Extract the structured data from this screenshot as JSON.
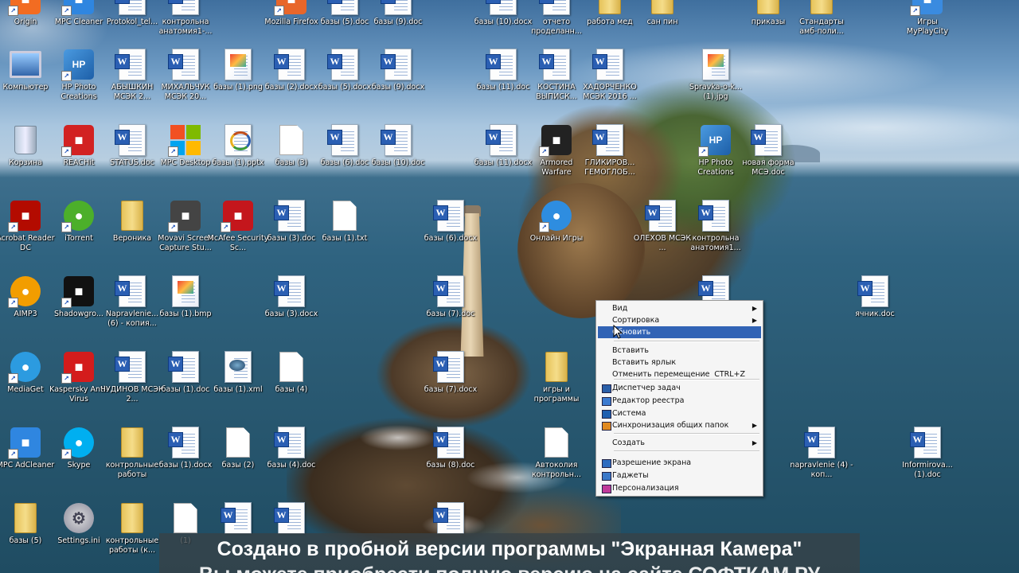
{
  "desktop_icons": [
    {
      "label": "Origin",
      "type": "app",
      "color": "#f26c22"
    },
    {
      "label": "MPC Cleaner",
      "type": "app",
      "color": "#2f86e0"
    },
    {
      "label": "Protokol_tel...",
      "type": "doc"
    },
    {
      "label": "контрольна анатомия1-...",
      "type": "doc"
    },
    {
      "label": "Mozilla Firefox",
      "type": "app",
      "color": "#e8662a"
    },
    {
      "label": "базы (5).doc",
      "type": "doc"
    },
    {
      "label": "базы (9).doc",
      "type": "doc"
    },
    {
      "label": "базы (10).docx",
      "type": "doc"
    },
    {
      "label": "отчето проделанн...",
      "type": "doc"
    },
    {
      "label": "работа мед",
      "type": "folder"
    },
    {
      "label": "сан пин",
      "type": "folder"
    },
    {
      "label": "приказы",
      "type": "folder"
    },
    {
      "label": "Стандарты амб-поли...",
      "type": "folder"
    },
    {
      "label": "Игры MyPlayCity",
      "type": "app",
      "color": "#3a8be0"
    },
    {
      "label": "Компьютер",
      "type": "computer"
    },
    {
      "label": "HP Photo Creations",
      "type": "hp"
    },
    {
      "label": "АБЫШКИН МСЭК 2...",
      "type": "doc"
    },
    {
      "label": "МИХАЛЬЧУК МСЭК 20...",
      "type": "doc"
    },
    {
      "label": "базы (1).png",
      "type": "img"
    },
    {
      "label": "базы (2).docx",
      "type": "doc"
    },
    {
      "label": "базы (5).docx",
      "type": "doc"
    },
    {
      "label": "базы (9).docx",
      "type": "doc"
    },
    {
      "label": "базы (11).doc",
      "type": "doc"
    },
    {
      "label": "КОСТИНА ВЫПИСК...",
      "type": "doc"
    },
    {
      "label": "ХАДОРЧЕНКО МСЭК 2016 ...",
      "type": "doc"
    },
    {
      "label": "Spravka-o-k... (1).jpg",
      "type": "img"
    },
    {
      "label": "Корзина",
      "type": "trash"
    },
    {
      "label": "REACHit",
      "type": "app",
      "color": "#d22222"
    },
    {
      "label": "STATUS.doc",
      "type": "doc"
    },
    {
      "label": "MPC Desktop",
      "type": "mswin"
    },
    {
      "label": "базы (1).pptx",
      "type": "pptx"
    },
    {
      "label": "базы (3)",
      "type": "plain"
    },
    {
      "label": "базы (6).doc",
      "type": "doc"
    },
    {
      "label": "базы (10).doc",
      "type": "doc"
    },
    {
      "label": "базы (11).docx",
      "type": "doc"
    },
    {
      "label": "Armored Warfare",
      "type": "app",
      "color": "#222"
    },
    {
      "label": "ГЛИКИРОВ... ГЕМОГЛОБ...",
      "type": "doc"
    },
    {
      "label": "HP Photo Creations",
      "type": "hp"
    },
    {
      "label": "новая форма МСЭ.doc",
      "type": "doc"
    },
    {
      "label": "Acrobat Reader DC",
      "type": "app",
      "color": "#b30b00"
    },
    {
      "label": "iTorrent",
      "type": "round",
      "color": "#4caf2a"
    },
    {
      "label": "Вероника",
      "type": "folder"
    },
    {
      "label": "Movavi Screen Capture Stu...",
      "type": "app",
      "color": "#444"
    },
    {
      "label": "McAfee Security Sc...",
      "type": "app",
      "color": "#c4161c"
    },
    {
      "label": "базы (3).doc",
      "type": "doc"
    },
    {
      "label": "базы (1).txt",
      "type": "plain"
    },
    {
      "label": "базы (6).docx",
      "type": "doc"
    },
    {
      "label": "Онлайн Игры",
      "type": "round",
      "color": "#2e8de0"
    },
    {
      "label": "ОЛЕХОВ МСЭК ...",
      "type": "doc"
    },
    {
      "label": "контрольна анатомия1...",
      "type": "doc"
    },
    {
      "label": "AIMP3",
      "type": "round",
      "color": "#f29d00"
    },
    {
      "label": "Shadowgro...",
      "type": "app",
      "color": "#111"
    },
    {
      "label": "Napravlenie... (6) - копия...",
      "type": "doc"
    },
    {
      "label": "базы (1).bmp",
      "type": "img"
    },
    {
      "label": "базы (3).docx",
      "type": "doc"
    },
    {
      "label": "базы (7).doc",
      "type": "doc"
    },
    {
      "label": "",
      "type": "doc"
    },
    {
      "label": "ячник.doc",
      "type": "doc"
    },
    {
      "label": "MediaGet",
      "type": "round",
      "color": "#2c9be0"
    },
    {
      "label": "Kaspersky Anti-Virus",
      "type": "app",
      "color": "#d41c1c"
    },
    {
      "label": "ЧУДИНОВ МСЭК 2...",
      "type": "doc"
    },
    {
      "label": "базы (1).doc",
      "type": "doc"
    },
    {
      "label": "базы (1).xml",
      "type": "xml"
    },
    {
      "label": "базы (4)",
      "type": "plain"
    },
    {
      "label": "базы (7).docx",
      "type": "doc"
    },
    {
      "label": "игры и программы",
      "type": "folder"
    },
    {
      "label": "MPC AdCleaner",
      "type": "app",
      "color": "#2f86e0"
    },
    {
      "label": "Skype",
      "type": "round",
      "color": "#00aff0"
    },
    {
      "label": "контрольные работы",
      "type": "folder"
    },
    {
      "label": "базы (1).docx",
      "type": "doc"
    },
    {
      "label": "базы (2)",
      "type": "plain"
    },
    {
      "label": "базы (4).doc",
      "type": "doc"
    },
    {
      "label": "базы (8).doc",
      "type": "doc"
    },
    {
      "label": "Автоколия контрольн...",
      "type": "plain"
    },
    {
      "label": "napravlenie (4) - коп...",
      "type": "doc"
    },
    {
      "label": "Informirova... (1).doc",
      "type": "doc"
    },
    {
      "label": "базы (5)",
      "type": "folder"
    },
    {
      "label": "Settings.ini",
      "type": "ini"
    },
    {
      "label": "контрольные работы (к...",
      "type": "folder"
    },
    {
      "label": "(1)",
      "type": "plain"
    },
    {
      "label": "",
      "type": "doc"
    },
    {
      "label": "",
      "type": "doc"
    },
    {
      "label": "",
      "type": "doc"
    }
  ],
  "context_menu": {
    "items": [
      {
        "label": "Вид",
        "submenu": true
      },
      {
        "label": "Сортировка",
        "submenu": true
      },
      {
        "label": "Обновить",
        "highlighted": true
      },
      {
        "label": "Вставить"
      },
      {
        "label": "Вставить ярлык"
      },
      {
        "label": "Отменить перемещение",
        "shortcut": "CTRL+Z"
      },
      {
        "label": "Диспетчер задач",
        "icon": "monitor-icon"
      },
      {
        "label": "Редактор реестра",
        "icon": "registry-icon"
      },
      {
        "label": "Система",
        "icon": "system-icon"
      },
      {
        "label": "Синхронизация общих папок",
        "icon": "sync-icon",
        "submenu": true
      },
      {
        "label": "Создать",
        "submenu": true
      },
      {
        "label": "Разрешение экрана",
        "icon": "display-icon"
      },
      {
        "label": "Гаджеты",
        "icon": "gadgets-icon"
      },
      {
        "label": "Персонализация",
        "icon": "personalize-icon"
      }
    ]
  },
  "watermark": {
    "line1": "Создано в пробной версии программы \"Экранная Камера\"",
    "line2": "Вы можете приобрести полную версию на сайте СОФТКАМ.РУ"
  },
  "colors": {
    "menu_highlight": "#3163b5",
    "word_blue": "#2b5fb3"
  }
}
